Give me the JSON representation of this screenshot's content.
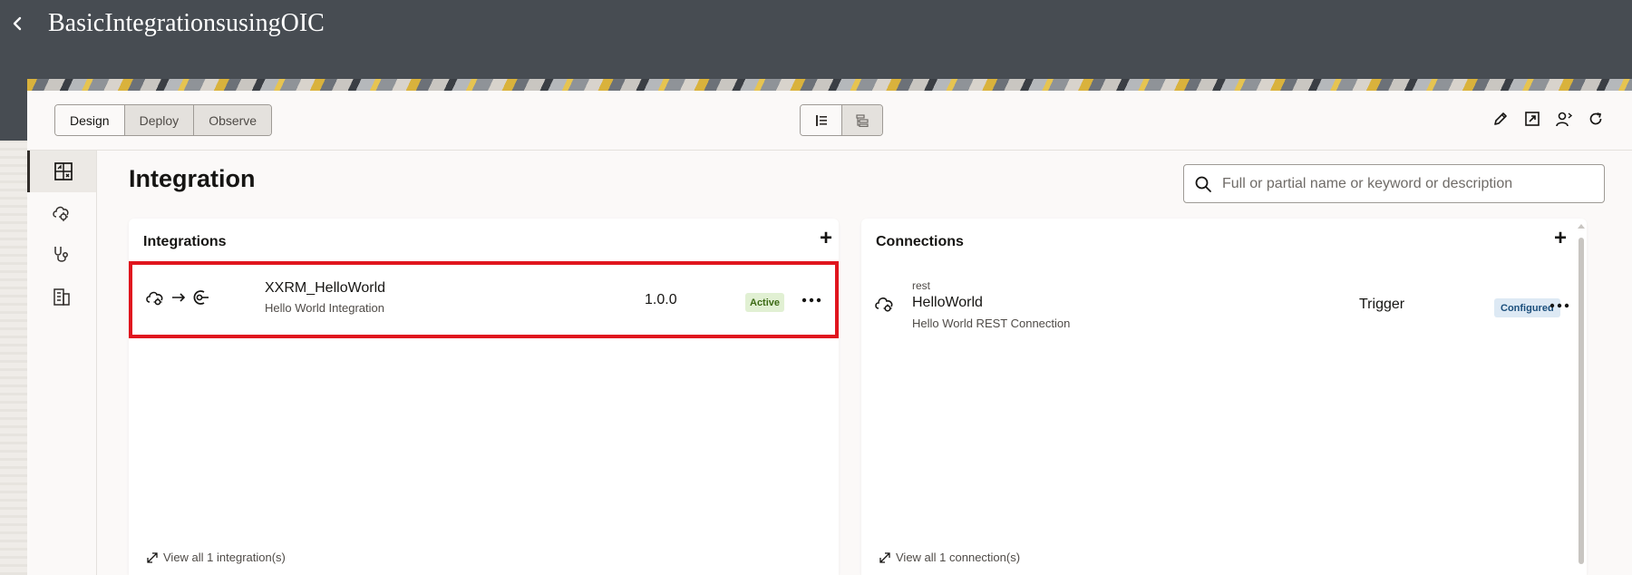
{
  "header": {
    "title": "BasicIntegrationsusingOIC",
    "back_icon": "chevron-left-icon"
  },
  "toolbar": {
    "tabs": [
      {
        "label": "Design",
        "active": true
      },
      {
        "label": "Deploy",
        "active": false
      },
      {
        "label": "Observe",
        "active": false
      }
    ],
    "view_modes": [
      {
        "icon": "list-view-icon",
        "active": true
      },
      {
        "icon": "tree-view-icon",
        "active": false
      }
    ],
    "actions": [
      "pencil-icon",
      "open-external-icon",
      "user-share-icon",
      "refresh-icon"
    ]
  },
  "rail": {
    "items": [
      {
        "icon": "integration-design-icon",
        "active": true
      },
      {
        "icon": "cloud-connection-icon",
        "active": false
      },
      {
        "icon": "stethoscope-icon",
        "active": false
      },
      {
        "icon": "building-icon",
        "active": false
      }
    ]
  },
  "page": {
    "title": "Integration",
    "search_placeholder": "Full or partial name or keyword or description"
  },
  "integrations": {
    "title": "Integrations",
    "items": [
      {
        "name": "XXRM_HelloWorld",
        "description": "Hello World Integration",
        "version": "1.0.0",
        "status": "Active"
      }
    ],
    "view_all": "View all 1 integration(s)"
  },
  "connections": {
    "title": "Connections",
    "items": [
      {
        "type": "rest",
        "name": "HelloWorld",
        "description": "Hello World REST Connection",
        "role": "Trigger",
        "status": "Configured"
      }
    ],
    "view_all": "View all 1 connection(s)"
  },
  "colors": {
    "header_bg": "#474c52",
    "highlight_border": "#e0151e",
    "active_badge_bg": "#e1f0d3",
    "configured_badge_bg": "#dde9f4"
  }
}
